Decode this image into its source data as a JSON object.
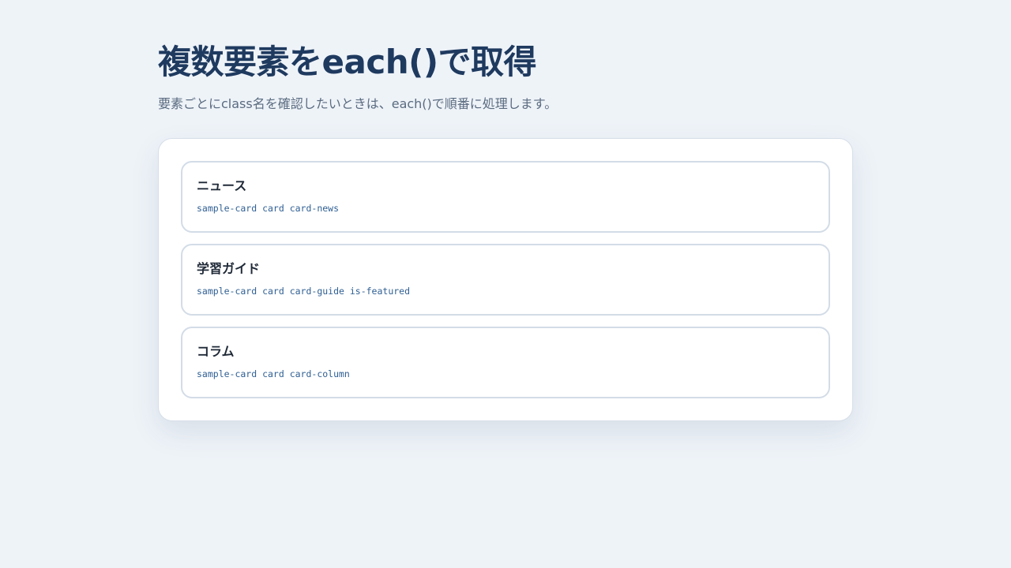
{
  "header": {
    "title": "複数要素をeach()で取得",
    "description": "要素ごとにclass名を確認したいときは、each()で順番に処理します。"
  },
  "cards": [
    {
      "title": "ニュース",
      "class_name": "sample-card card card-news"
    },
    {
      "title": "学習ガイド",
      "class_name": "sample-card card card-guide is-featured"
    },
    {
      "title": "コラム",
      "class_name": "sample-card card card-column"
    }
  ],
  "colors": {
    "background": "#eef3f8",
    "title": "#1f3a5f",
    "class_text": "#2f5f93"
  }
}
